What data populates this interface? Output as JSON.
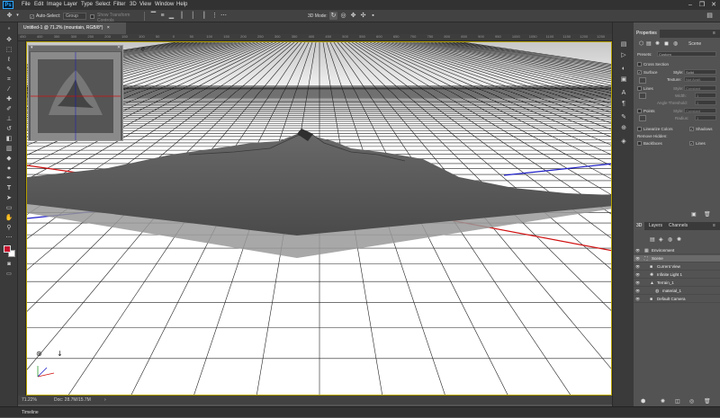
{
  "app": {
    "logo": "Ps"
  },
  "menu": [
    "File",
    "Edit",
    "Image",
    "Layer",
    "Type",
    "Select",
    "Filter",
    "3D",
    "View",
    "Window",
    "Help"
  ],
  "window_controls": {
    "minimize": "–",
    "maximize": "❐",
    "close": "✕"
  },
  "options": {
    "auto_select_label": "Auto-Select:",
    "auto_select_value": "Group",
    "show_transform": "Show Transform Controls",
    "mode_label": "3D Mode:"
  },
  "document": {
    "tab_title": "Untitled-1 @ 71.2% (mountain, RGB/8*)",
    "tab_close": "×"
  },
  "ruler": {
    "top_ticks": [
      "450",
      "400",
      "350",
      "300",
      "250",
      "200",
      "150",
      "100",
      "50",
      "0",
      "50",
      "100",
      "150",
      "200",
      "250",
      "300",
      "350",
      "400",
      "450",
      "500",
      "550",
      "600",
      "650",
      "700",
      "750",
      "800",
      "850",
      "900",
      "950",
      "1000",
      "1050",
      "1100",
      "1150",
      "1200",
      "1250"
    ]
  },
  "status": {
    "zoom": "71.22%",
    "doc": "Doc: 28.7M/15.7M",
    "arrow": "›"
  },
  "timeline": {
    "label": "Timeline"
  },
  "properties": {
    "tab": "Properties",
    "panel_title": "Scene",
    "presets_label": "Presets:",
    "presets_value": "Custom",
    "cross_section": "Cross Section",
    "surface": "Surface",
    "style_label": "Style:",
    "style_value": "Solid",
    "texture_label": "Texture:",
    "texture_value": "Not Avail.",
    "lines": "Lines",
    "lines_style_label": "Style:",
    "lines_style_value": "Constant",
    "width_label": "Width:",
    "width_value": "1",
    "angle_label": "Angle Threshold:",
    "angle_value": "1",
    "points": "Points",
    "points_style_label": "Style:",
    "points_style_value": "Constant",
    "radius_label": "Radius:",
    "radius_value": "1",
    "linearize": "Linearize Colors",
    "shadows": "Shadows",
    "remove_hidden": "Remove Hidden:",
    "backfaces": "Backfaces",
    "lines_hidden": "Lines"
  },
  "layers_panel": {
    "tab_3d": "3D",
    "tab_layers": "Layers",
    "tab_channels": "Channels",
    "items": [
      {
        "name": "Environment",
        "indent": 0,
        "icon": "▦"
      },
      {
        "name": "Scene",
        "indent": 0,
        "icon": "⛶"
      },
      {
        "name": "Current View",
        "indent": 1,
        "icon": "■"
      },
      {
        "name": "Infinite Light 1",
        "indent": 1,
        "icon": "✺"
      },
      {
        "name": "Terrain_1",
        "indent": 1,
        "icon": "▲"
      },
      {
        "name": "material_1",
        "indent": 2,
        "icon": "◍"
      },
      {
        "name": "Default Camera",
        "indent": 1,
        "icon": "■"
      }
    ]
  },
  "colors": {
    "foreground": "#c8102e",
    "background": "#ffffff",
    "accent_yellow": "#b5a000"
  }
}
